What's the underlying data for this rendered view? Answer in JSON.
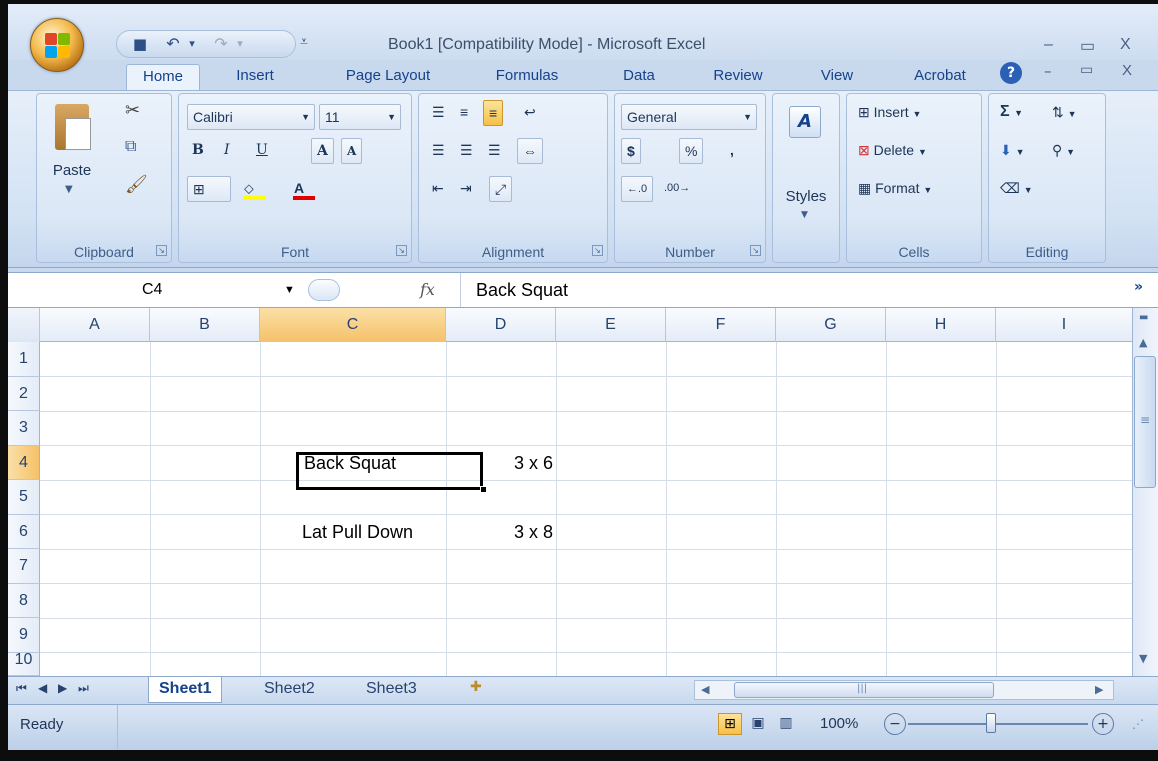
{
  "app": {
    "title": "Book1  [Compatibility Mode] - Microsoft Excel",
    "window_controls": [
      "–",
      "▭",
      "X"
    ],
    "doc_controls": [
      "–",
      "▭",
      "X"
    ],
    "help_icon": "help-icon"
  },
  "qat": {
    "undo": "↶",
    "redo": "↷",
    "more": "▾"
  },
  "tabs": [
    "Home",
    "Insert",
    "Page Layout",
    "Formulas",
    "Data",
    "Review",
    "View",
    "Acrobat"
  ],
  "active_tab": "Home",
  "ribbon": {
    "clipboard": {
      "label": "Clipboard",
      "paste": "Paste"
    },
    "font": {
      "label": "Font",
      "family": "Calibri",
      "size": "11",
      "bold": "B",
      "italic": "I",
      "underline": "U",
      "grow": "A",
      "shrink": "A"
    },
    "alignment": {
      "label": "Alignment"
    },
    "number": {
      "label": "Number",
      "format": "General",
      "currency": "$",
      "percent": "%",
      "comma": ","
    },
    "styles": {
      "label": "Styles"
    },
    "cells": {
      "label": "Cells",
      "insert": "Insert",
      "delete": "Delete",
      "format": "Format"
    },
    "editing": {
      "label": "Editing",
      "sum": "Σ"
    }
  },
  "formula_bar": {
    "name_box": "C4",
    "fx": "fx",
    "content": "Back Squat"
  },
  "columns": [
    "A",
    "B",
    "C",
    "D",
    "E",
    "F",
    "G",
    "H",
    "I"
  ],
  "active_column": "C",
  "rows": [
    "1",
    "2",
    "3",
    "4",
    "5",
    "6",
    "7",
    "8",
    "9",
    "10"
  ],
  "active_row": "4",
  "cells": {
    "C4": "Back Squat",
    "D4": "3 x 6",
    "C6": "Lat Pull Down",
    "D6": "3 x 8"
  },
  "sheets": [
    "Sheet1",
    "Sheet2",
    "Sheet3"
  ],
  "active_sheet": "Sheet1",
  "status": {
    "ready": "Ready",
    "zoom": "100%",
    "zoom_out": "−",
    "zoom_in": "+"
  },
  "colors": {
    "accent": "#15428b",
    "ribbon": "#d3e2f4",
    "selected": "#f6c046"
  }
}
